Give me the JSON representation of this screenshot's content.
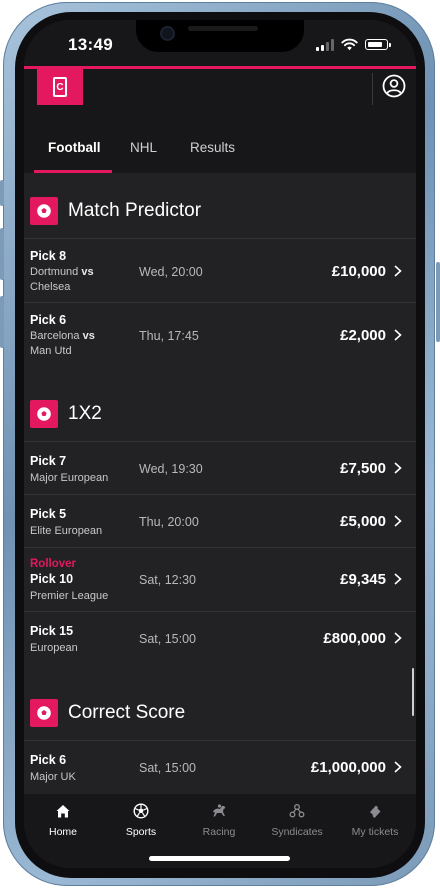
{
  "status_bar": {
    "time": "13:49"
  },
  "header": {
    "logo_letter": "C"
  },
  "tabs": [
    {
      "label": "Football",
      "active": true
    },
    {
      "label": "NHL",
      "active": false
    },
    {
      "label": "Results",
      "active": false
    }
  ],
  "sections": {
    "match_predictor": {
      "title": "Match Predictor",
      "rows": [
        {
          "pick": "Pick 8",
          "home": "Dortmund",
          "vs": "vs",
          "away": "Chelsea",
          "when": "Wed, 20:00",
          "amount": "£10,000"
        },
        {
          "pick": "Pick 6",
          "home": "Barcelona",
          "vs": "vs",
          "away": "Man Utd",
          "when": "Thu, 17:45",
          "amount": "£2,000"
        }
      ]
    },
    "one_x_two": {
      "title": "1X2",
      "rows": [
        {
          "pick": "Pick 7",
          "sub": "Major European",
          "when": "Wed, 19:30",
          "amount": "£7,500"
        },
        {
          "pick": "Pick 5",
          "sub": "Elite European",
          "when": "Thu, 20:00",
          "amount": "£5,000"
        },
        {
          "badge": "Rollover",
          "pick": "Pick 10",
          "sub": "Premier League",
          "when": "Sat, 12:30",
          "amount": "£9,345"
        },
        {
          "pick": "Pick 15",
          "sub": "European",
          "when": "Sat, 15:00",
          "amount": "£800,000"
        }
      ]
    },
    "correct_score": {
      "title": "Correct Score",
      "rows": [
        {
          "pick": "Pick 6",
          "sub": "Major UK",
          "when": "Sat, 15:00",
          "amount": "£1,000,000"
        }
      ]
    }
  },
  "bottom_nav": [
    {
      "label": "Home",
      "icon": "home-icon",
      "active": true
    },
    {
      "label": "Sports",
      "icon": "football-icon",
      "active": true
    },
    {
      "label": "Racing",
      "icon": "horse-racing-icon",
      "active": false
    },
    {
      "label": "Syndicates",
      "icon": "syndicates-icon",
      "active": false
    },
    {
      "label": "My tickets",
      "icon": "ticket-icon",
      "active": false
    }
  ],
  "colors": {
    "accent": "#e3185e",
    "background": "#222224",
    "bar": "#171719"
  }
}
